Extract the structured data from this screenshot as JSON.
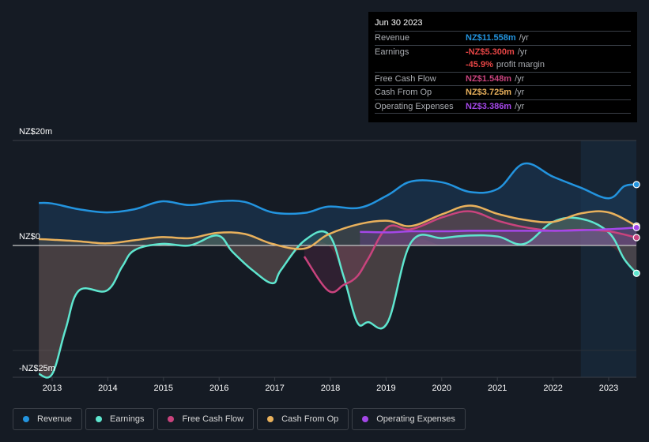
{
  "tooltip": {
    "date": "Jun 30 2023",
    "rows": [
      {
        "label": "Revenue",
        "value": "NZ$11.558m",
        "unit": "/yr",
        "color": "#2394df"
      },
      {
        "label": "Earnings",
        "value": "-NZ$5.300m",
        "unit": "/yr",
        "color": "#e64545"
      },
      {
        "label": "",
        "value": "-45.9%",
        "unit": "profit margin",
        "color": "#e64545"
      },
      {
        "label": "Free Cash Flow",
        "value": "NZ$1.548m",
        "unit": "/yr",
        "color": "#c9437d"
      },
      {
        "label": "Cash From Op",
        "value": "NZ$3.725m",
        "unit": "/yr",
        "color": "#e9b15c"
      },
      {
        "label": "Operating Expenses",
        "value": "NZ$3.386m",
        "unit": "/yr",
        "color": "#a447e8"
      }
    ]
  },
  "legend": [
    {
      "label": "Revenue",
      "color": "#2394df"
    },
    {
      "label": "Earnings",
      "color": "#5ee6cf"
    },
    {
      "label": "Free Cash Flow",
      "color": "#c9437d"
    },
    {
      "label": "Cash From Op",
      "color": "#e9b15c"
    },
    {
      "label": "Operating Expenses",
      "color": "#a447e8"
    }
  ],
  "chart_data": {
    "type": "line",
    "title": "",
    "xlabel": "",
    "ylabel": "",
    "y_tick_labels": [
      "NZ$20m",
      "NZ$0",
      "-NZ$25m"
    ],
    "y_ticks": [
      20,
      0,
      -25
    ],
    "ylim": [
      -25,
      20
    ],
    "x_tick_labels": [
      "2013",
      "2014",
      "2015",
      "2016",
      "2017",
      "2018",
      "2019",
      "2020",
      "2021",
      "2022",
      "2023"
    ],
    "x_ticks": [
      2013,
      2014,
      2015,
      2016,
      2017,
      2018,
      2019,
      2020,
      2021,
      2022,
      2023
    ],
    "xlim": [
      2012.76,
      2023.5
    ],
    "forecast_shade_start": 2022.5,
    "legend_position": "bottom",
    "series": [
      {
        "name": "Revenue",
        "color": "#2394df",
        "x": [
          2012.76,
          2013.0,
          2013.48,
          2013.98,
          2014.48,
          2014.97,
          2015.47,
          2015.97,
          2016.46,
          2016.96,
          2017.53,
          2017.96,
          2018.53,
          2019.03,
          2019.45,
          2020.02,
          2020.51,
          2021.01,
          2021.48,
          2022.0,
          2022.5,
          2023.0,
          2023.28,
          2023.5
        ],
        "values": [
          8.1,
          8.0,
          6.9,
          6.3,
          6.9,
          8.4,
          7.7,
          8.4,
          8.3,
          6.3,
          6.2,
          7.4,
          7.2,
          9.6,
          12.2,
          12.0,
          10.2,
          10.8,
          15.6,
          13.1,
          11.0,
          9.0,
          11.3,
          11.6
        ]
      },
      {
        "name": "Earnings",
        "color": "#5ee6cf",
        "x": [
          2012.76,
          2013.0,
          2013.24,
          2013.48,
          2013.98,
          2014.26,
          2014.48,
          2014.97,
          2015.47,
          2015.97,
          2016.24,
          2016.6,
          2016.96,
          2017.11,
          2017.53,
          2017.96,
          2018.24,
          2018.48,
          2018.68,
          2019.03,
          2019.45,
          2020.02,
          2020.51,
          2021.01,
          2021.48,
          2022.0,
          2022.5,
          2023.0,
          2023.28,
          2023.5
        ],
        "values": [
          -24.5,
          -24.5,
          -16.0,
          -8.6,
          -8.6,
          -4.0,
          -0.9,
          0.3,
          0.0,
          1.9,
          -1.2,
          -4.7,
          -7.2,
          -4.7,
          0.9,
          2.2,
          -6.0,
          -14.6,
          -14.6,
          -14.6,
          0.6,
          1.4,
          1.9,
          1.7,
          0.3,
          4.5,
          5.1,
          2.5,
          -2.6,
          -5.3
        ]
      },
      {
        "name": "Free Cash Flow",
        "color": "#c9437d",
        "x": [
          2017.53,
          2017.96,
          2018.24,
          2018.48,
          2018.68,
          2019.03,
          2019.45,
          2020.02,
          2020.51,
          2021.01,
          2021.48,
          2022.0,
          2022.5,
          2023.0,
          2023.5
        ],
        "values": [
          -2.1,
          -8.6,
          -7.5,
          -5.9,
          -2.5,
          3.5,
          3.1,
          5.4,
          6.5,
          4.7,
          3.5,
          2.8,
          3.0,
          2.7,
          1.5
        ]
      },
      {
        "name": "Cash From Op",
        "color": "#e9b15c",
        "x": [
          2012.76,
          2013.0,
          2013.48,
          2013.98,
          2014.48,
          2014.97,
          2015.47,
          2015.97,
          2016.46,
          2016.96,
          2017.53,
          2017.96,
          2018.53,
          2019.03,
          2019.45,
          2020.02,
          2020.51,
          2021.01,
          2021.48,
          2022.0,
          2022.5,
          2023.0,
          2023.5
        ],
        "values": [
          1.2,
          1.1,
          0.8,
          0.4,
          1.0,
          1.6,
          1.4,
          2.4,
          2.2,
          0.3,
          -0.6,
          2.1,
          4.1,
          4.7,
          3.7,
          6.0,
          7.6,
          6.0,
          4.9,
          4.5,
          6.1,
          6.3,
          3.7
        ]
      },
      {
        "name": "Operating Expenses",
        "color": "#a447e8",
        "x": [
          2018.53,
          2019.03,
          2019.45,
          2020.02,
          2020.51,
          2021.01,
          2021.48,
          2022.0,
          2022.5,
          2023.0,
          2023.5
        ],
        "values": [
          2.6,
          2.5,
          2.7,
          2.7,
          2.8,
          2.8,
          2.8,
          2.8,
          2.9,
          3.1,
          3.4
        ]
      }
    ]
  }
}
